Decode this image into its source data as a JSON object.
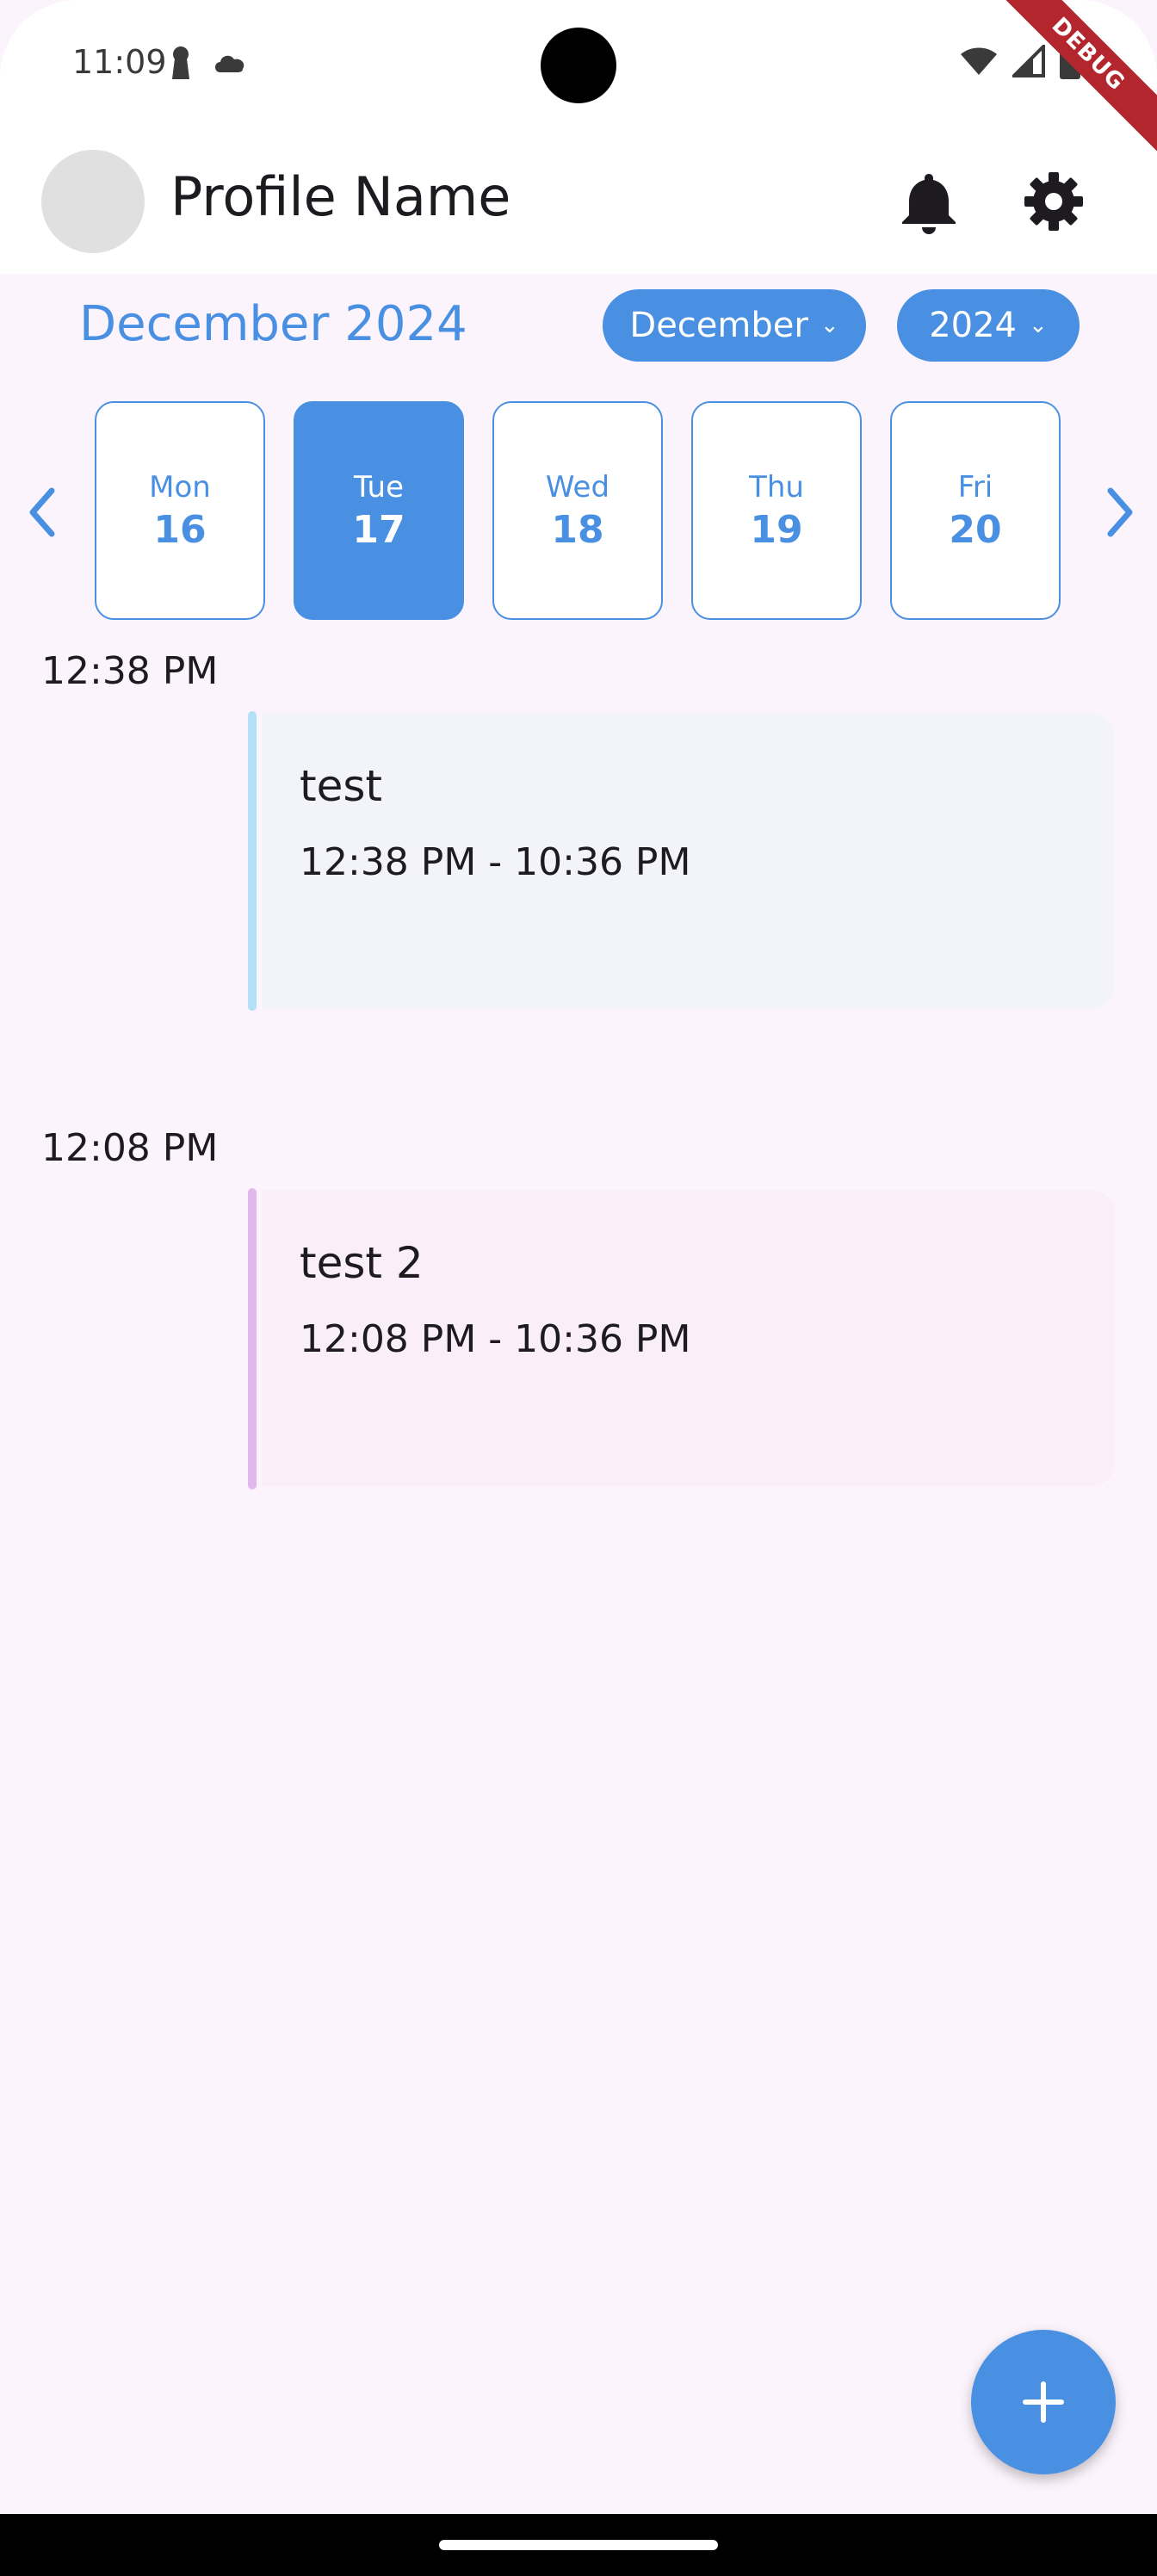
{
  "status_bar": {
    "time": "11:09"
  },
  "debug_banner": "DEBUG",
  "app_bar": {
    "profile_name": "Profile Name",
    "icons": [
      "notifications-icon",
      "settings-gear-icon"
    ]
  },
  "calendar": {
    "title": "December 2024",
    "month_dropdown": "December",
    "year_dropdown": "2024",
    "days": [
      {
        "dow": "Mon",
        "num": "16"
      },
      {
        "dow": "Tue",
        "num": "17"
      },
      {
        "dow": "Wed",
        "num": "18"
      },
      {
        "dow": "Thu",
        "num": "19"
      },
      {
        "dow": "Fri",
        "num": "20"
      }
    ],
    "selected_day": "Tue 17"
  },
  "events": [
    {
      "time": "12:38 PM",
      "title": "test",
      "range": "12:38 PM - 10:36 PM",
      "accent": "#b3e0f7",
      "bg": "#f3f3fc"
    },
    {
      "time": "12:08 PM",
      "title": "test 2",
      "range": "12:08 PM - 10:36 PM",
      "accent": "#e1b8ec",
      "bg": "#f9eef9"
    }
  ],
  "colors": {
    "primary": "#4a90e2",
    "background": "#fcf4fc"
  }
}
